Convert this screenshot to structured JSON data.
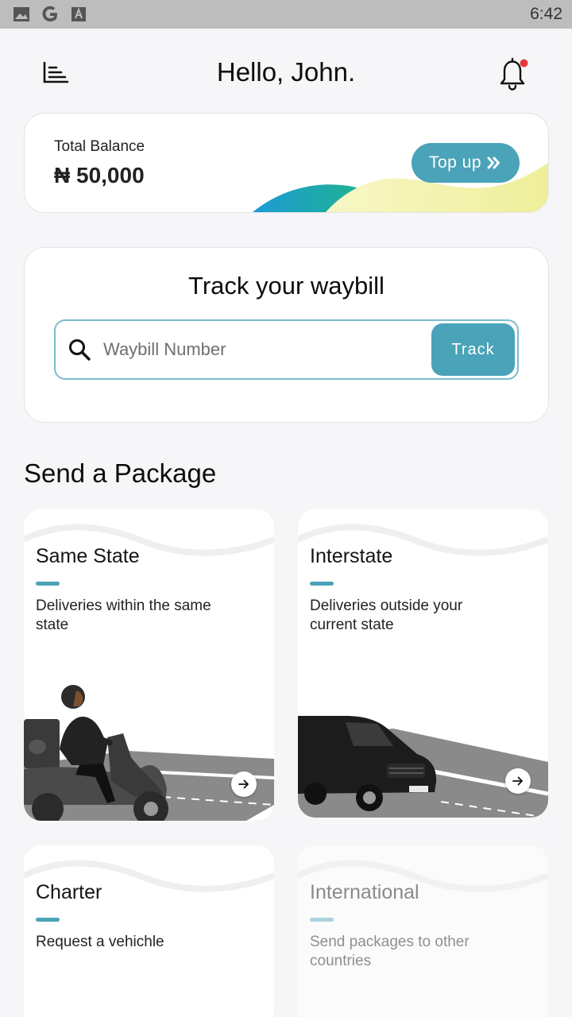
{
  "status_bar": {
    "time": "6:42",
    "icons": [
      "image-icon",
      "google-icon",
      "font-icon"
    ]
  },
  "header": {
    "greeting": "Hello, John.",
    "menu_icon": "menu-icon",
    "notification_icon": "bell-icon",
    "has_notification": true
  },
  "balance": {
    "label": "Total Balance",
    "value": "₦ 50,000",
    "topup_label": "Top up",
    "topup_icon": "double-chevron-right-icon"
  },
  "track": {
    "title": "Track your waybill",
    "placeholder": "Waybill Number",
    "button_label": "Track"
  },
  "send": {
    "title": "Send a Package",
    "options": [
      {
        "title": "Same State",
        "description": "Deliveries within the same state"
      },
      {
        "title": "Interstate",
        "description": "Deliveries outside your current state"
      },
      {
        "title": "Charter",
        "description": "Request a vehichle"
      },
      {
        "title": "International",
        "description": "Send packages to other countries",
        "disabled": true
      }
    ]
  },
  "colors": {
    "accent": "#4aa3b8",
    "background": "#f6f6f8",
    "notification_dot": "#e53935",
    "status_bar": "#bdbdbd"
  }
}
